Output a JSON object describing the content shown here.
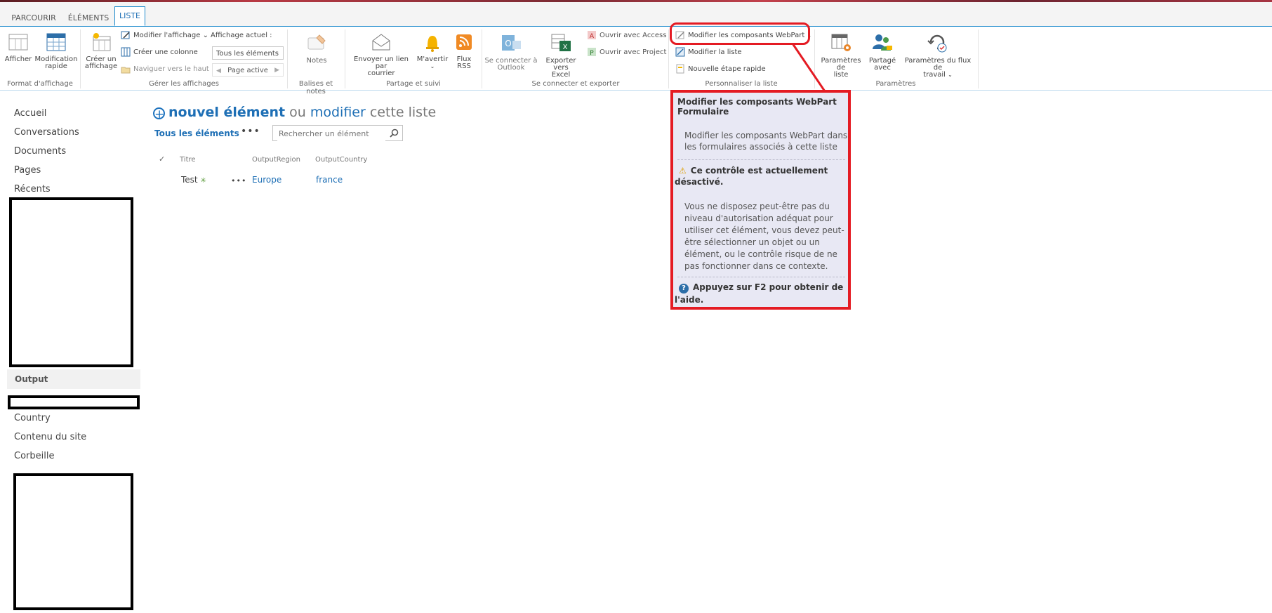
{
  "tabs": [
    {
      "label": "PARCOURIR"
    },
    {
      "label": "ÉLÉMENTS"
    },
    {
      "label": "LISTE"
    }
  ],
  "ribbon": {
    "format_affichage": {
      "label": "Format d'affichage",
      "afficher": "Afficher",
      "modification_rapide": [
        "Modification",
        "rapide"
      ]
    },
    "gerer_affichages": {
      "label": "Gérer les affichages",
      "creer_affichage": [
        "Créer un",
        "affichage"
      ],
      "modifier_affichage": "Modifier l'affichage",
      "creer_colonne": "Créer une colonne",
      "naviguer_haut": "Naviguer vers le haut",
      "affichage_actuel_label": "Affichage actuel :",
      "affichage_actuel_value": "Tous les éléments",
      "page_active": "Page active"
    },
    "balises": {
      "label": "Balises et notes",
      "notes": "Notes"
    },
    "partage": {
      "label": "Partage et suivi",
      "envoyer_lien": [
        "Envoyer un lien par",
        "courrier"
      ],
      "m_avertir": "M'avertir",
      "flux_rss": [
        "Flux",
        "RSS"
      ]
    },
    "connecter": {
      "label": "Se connecter et exporter",
      "outlook": [
        "Se connecter à",
        "Outlook"
      ],
      "excel": [
        "Exporter vers",
        "Excel"
      ],
      "access": "Ouvrir avec Access",
      "project": "Ouvrir avec Project"
    },
    "personnaliser": {
      "label": "Personnaliser la liste",
      "webpart": "Modifier les composants WebPart",
      "modifier_liste": "Modifier la liste",
      "nouvelle_etape": "Nouvelle étape rapide"
    },
    "parametres": {
      "label": "Paramètres",
      "parametres_liste": [
        "Paramètres de",
        "liste"
      ],
      "partage_avec": [
        "Partagé",
        "avec"
      ],
      "flux_travail": [
        "Paramètres du flux de",
        "travail"
      ]
    }
  },
  "nav": {
    "items_top": [
      "Accueil",
      "Conversations",
      "Documents",
      "Pages",
      "Récents"
    ],
    "output": "Output",
    "items_bottom": [
      "Country",
      "Contenu du site",
      "Corbeille"
    ]
  },
  "main": {
    "nouvel_element": "nouvel élément",
    "ou": "ou",
    "modifier": "modifier",
    "cette_liste": "cette liste",
    "view_link": "Tous les éléments",
    "search_placeholder": "Rechercher un élément",
    "columns": [
      "Titre",
      "OutputRegion",
      "OutputCountry"
    ],
    "rows": [
      {
        "titre": "Test",
        "region": "Europe",
        "country": "france"
      }
    ]
  },
  "tooltip": {
    "title_line1": "Modifier les composants WebPart",
    "title_line2": "Formulaire",
    "desc_line1": "Modifier les composants WebPart dans",
    "desc_line2": "les formulaires associés à cette liste",
    "disabled_line1": "Ce contrôle est actuellement",
    "disabled_line2": "désactivé.",
    "reason": [
      "Vous ne disposez peut-être pas du",
      "niveau d'autorisation adéquat pour",
      "utiliser cet élément, vous devez peut-",
      "être sélectionner un objet ou un",
      "élément, ou le contrôle risque de ne",
      "pas fonctionner dans ce contexte."
    ],
    "help_line1": "Appuyez sur F2 pour obtenir de",
    "help_line2": "l'aide."
  },
  "colors": {
    "accent": "#1e6fb5",
    "highlight": "#e41b23",
    "tooltip_bg": "#e8e8f4"
  }
}
